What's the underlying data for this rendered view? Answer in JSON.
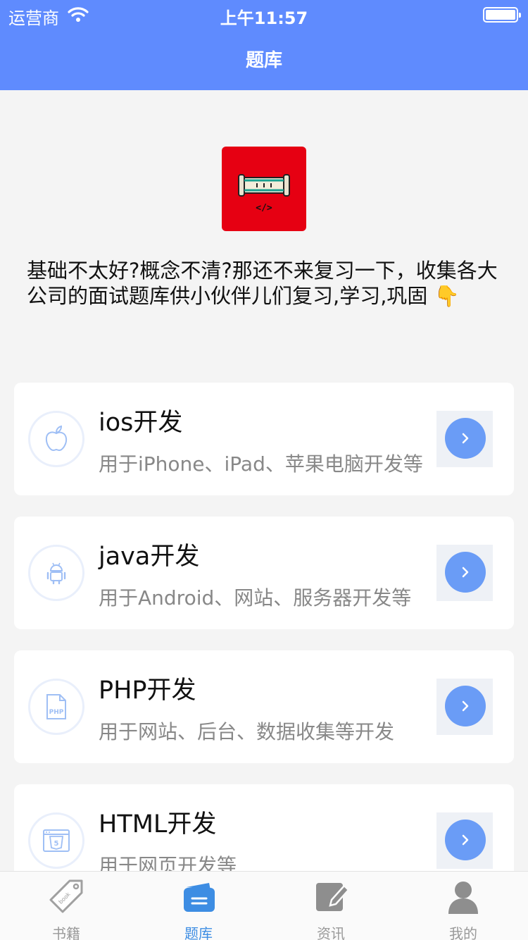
{
  "status_bar": {
    "carrier": "运营商",
    "time": "上午11:57",
    "battery_level": 1.0
  },
  "nav": {
    "title": "题库"
  },
  "hero": {
    "logo_text": "</>",
    "description": "基础不太好?概念不清?那还不来复习一下，收集各大公司的面试题库供小伙伴儿们复习,学习,巩固 👇"
  },
  "courses": [
    {
      "title": "ios开发",
      "desc": "用于iPhone、iPad、苹果电脑开发等",
      "icon": "apple-icon"
    },
    {
      "title": "java开发",
      "desc": "用于Android、网站、服务器开发等",
      "icon": "android-icon"
    },
    {
      "title": "PHP开发",
      "desc": "用于网站、后台、数据收集等开发",
      "icon": "php-file-icon",
      "icon_text": "PHP"
    },
    {
      "title": "HTML开发",
      "desc": "用于网页开发等",
      "icon": "html5-icon",
      "icon_text": "5"
    }
  ],
  "tabs": [
    {
      "label": "书籍",
      "icon": "book-tag-icon",
      "icon_text": "book"
    },
    {
      "label": "题库",
      "icon": "question-bank-icon",
      "active": true
    },
    {
      "label": "资讯",
      "icon": "news-icon"
    },
    {
      "label": "我的",
      "icon": "profile-icon"
    }
  ],
  "colors": {
    "primary": "#5f8bfe",
    "logo_bg": "#e60012",
    "go_button": "#6a9cf6",
    "active_tab": "#3d8de3"
  }
}
